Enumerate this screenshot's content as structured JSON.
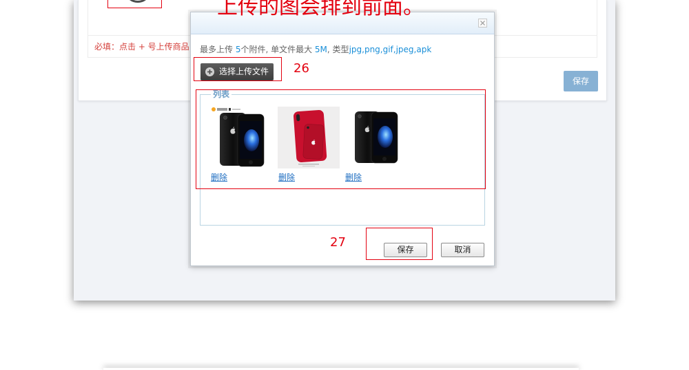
{
  "annotations": {
    "headline": "上传的图会排到前面。",
    "select_step": "26",
    "save_step": "27"
  },
  "background_form": {
    "required_hint": "必填：点击 + 号上传商品",
    "save_label": "保存"
  },
  "dialog": {
    "upload_rules": {
      "text_1": "最多上传 ",
      "max_files": "5",
      "text_2": "个附件, 单文件最大 ",
      "max_size": "5M",
      "text_3": ", 类型",
      "types": "jpg,png,gif,jpeg,apk"
    },
    "select_button_label": "选择上传文件",
    "list_legend": "列表",
    "items": [
      {
        "delete_label": "删除"
      },
      {
        "delete_label": "删除"
      },
      {
        "delete_label": "删除"
      }
    ],
    "save_label": "保存",
    "cancel_label": "取消"
  },
  "icons": {
    "close": "close-icon",
    "select_file": "plus-circle-icon",
    "upload_placeholder": "upload-circle-icon"
  },
  "colors": {
    "annotation_red": "#e3000f",
    "accent_blue": "#1a8fd8",
    "link_blue": "#1f6ec1",
    "legend_blue": "#6e9fc7",
    "primary_button": "#87b1d4"
  }
}
